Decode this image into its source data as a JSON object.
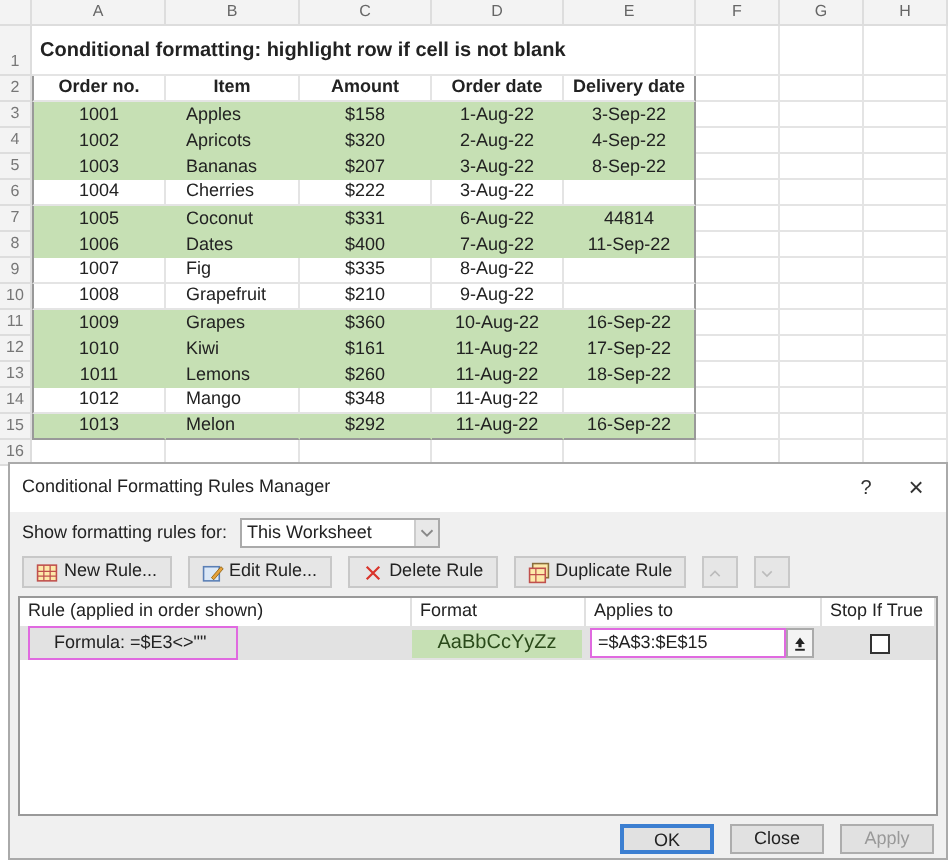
{
  "sheet": {
    "columns": [
      "A",
      "B",
      "C",
      "D",
      "E",
      "F",
      "G",
      "H"
    ],
    "row_numbers": [
      "1",
      "2",
      "3",
      "4",
      "5",
      "6",
      "7",
      "8",
      "9",
      "10",
      "11",
      "12",
      "13",
      "14",
      "15",
      "16"
    ],
    "title": "Conditional formatting: highlight row if cell is not blank",
    "headers": [
      "Order no.",
      "Item",
      "Amount",
      "Order date",
      "Delivery date"
    ],
    "rows": [
      {
        "cells": [
          "1001",
          "Apples",
          "$158",
          "1-Aug-22",
          "3-Sep-22"
        ],
        "highlighted": true
      },
      {
        "cells": [
          "1002",
          "Apricots",
          "$320",
          "2-Aug-22",
          "4-Sep-22"
        ],
        "highlighted": true
      },
      {
        "cells": [
          "1003",
          "Bananas",
          "$207",
          "3-Aug-22",
          "8-Sep-22"
        ],
        "highlighted": true
      },
      {
        "cells": [
          "1004",
          "Cherries",
          "$222",
          "3-Aug-22",
          ""
        ],
        "highlighted": false
      },
      {
        "cells": [
          "1005",
          "Coconut",
          "$331",
          "6-Aug-22",
          "44814"
        ],
        "highlighted": true
      },
      {
        "cells": [
          "1006",
          "Dates",
          "$400",
          "7-Aug-22",
          "11-Sep-22"
        ],
        "highlighted": true
      },
      {
        "cells": [
          "1007",
          "Fig",
          "$335",
          "8-Aug-22",
          ""
        ],
        "highlighted": false
      },
      {
        "cells": [
          "1008",
          "Grapefruit",
          "$210",
          "9-Aug-22",
          ""
        ],
        "highlighted": false
      },
      {
        "cells": [
          "1009",
          "Grapes",
          "$360",
          "10-Aug-22",
          "16-Sep-22"
        ],
        "highlighted": true
      },
      {
        "cells": [
          "1010",
          "Kiwi",
          "$161",
          "11-Aug-22",
          "17-Sep-22"
        ],
        "highlighted": true
      },
      {
        "cells": [
          "1011",
          "Lemons",
          "$260",
          "11-Aug-22",
          "18-Sep-22"
        ],
        "highlighted": true
      },
      {
        "cells": [
          "1012",
          "Mango",
          "$348",
          "11-Aug-22",
          ""
        ],
        "highlighted": false
      },
      {
        "cells": [
          "1013",
          "Melon",
          "$292",
          "11-Aug-22",
          "16-Sep-22"
        ],
        "highlighted": true
      }
    ]
  },
  "dialog": {
    "title": "Conditional Formatting Rules Manager",
    "help": "?",
    "close": "×",
    "filter_label": "Show formatting rules for:",
    "filter_value": "This Worksheet",
    "toolbar": [
      {
        "kind": "new",
        "label": "New Rule...",
        "disabled": false
      },
      {
        "kind": "edit",
        "label": "Edit Rule...",
        "disabled": false
      },
      {
        "kind": "delete",
        "label": "Delete Rule",
        "disabled": false
      },
      {
        "kind": "duplicate",
        "label": "Duplicate Rule",
        "disabled": false
      },
      {
        "kind": "up",
        "disabled": true
      },
      {
        "kind": "down",
        "disabled": true
      }
    ],
    "columns": [
      "Rule (applied in order shown)",
      "Format",
      "Applies to",
      "Stop If True"
    ],
    "rules": [
      {
        "rule": "Formula: =$E3<>\"\"",
        "format_preview": "AaBbCcYyZz",
        "applies_to": "=$A$3:$E$15",
        "stop_if_true": false,
        "selected": true
      }
    ],
    "buttons": [
      {
        "label": "OK",
        "default": true,
        "disabled": false
      },
      {
        "label": "Close",
        "default": false,
        "disabled": false
      },
      {
        "label": "Apply",
        "default": false,
        "disabled": true
      }
    ]
  }
}
